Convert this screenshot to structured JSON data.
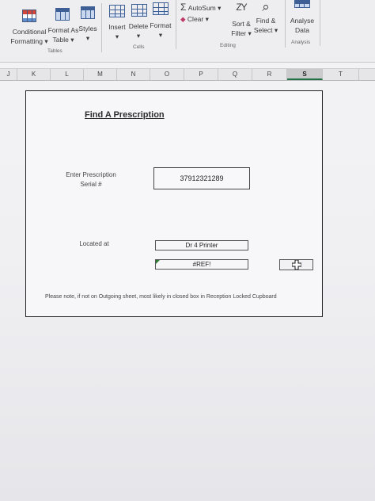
{
  "ribbon": {
    "conditional_formatting": {
      "line1": "Conditional",
      "line2": "Formatting ▾"
    },
    "format_as_table": {
      "line1": "Format As",
      "line2": "Table ▾"
    },
    "styles": {
      "line1": "Styles",
      "line2": "▾"
    },
    "tables_label": "Tables",
    "insert": {
      "line1": "Insert",
      "line2": "▾"
    },
    "delete": {
      "line1": "Delete",
      "line2": "▾"
    },
    "format": {
      "line1": "Format",
      "line2": "▾"
    },
    "cells_label": "Cells",
    "autosum": "AutoSum ▾",
    "autosum_glyph": "Σ",
    "clear": "Clear ▾",
    "sort_filter": {
      "line1": "Sort &",
      "line2": "Filter ▾",
      "glyph": "ZY"
    },
    "find_select": {
      "line1": "Find &",
      "line2": "Select ▾",
      "glyph": "⌕"
    },
    "editing_label": "Editing",
    "analyse_data": {
      "line1": "Analyse",
      "line2": "Data"
    },
    "analysis_label": "Analysis"
  },
  "columns": [
    "J",
    "K",
    "L",
    "M",
    "N",
    "O",
    "P",
    "Q",
    "R",
    "S",
    "T"
  ],
  "selected_column": "S",
  "form": {
    "title": "Find A Prescription",
    "serial_label_line1": "Enter Prescription",
    "serial_label_line2": "Serial #",
    "serial_value": "37912321289",
    "located_label": "Located at",
    "located_value": "Dr 4 Printer",
    "error_value": "#REF!",
    "note": "Please note, if not on Outgoing sheet, most likely in closed box in Reception Locked Cupboard"
  },
  "icons": {
    "cursor": "plus-cursor-icon",
    "error_indicator": "green-triangle-icon"
  },
  "colors": {
    "selected_column_accent": "#217346",
    "error_indicator": "#2e7d32"
  }
}
